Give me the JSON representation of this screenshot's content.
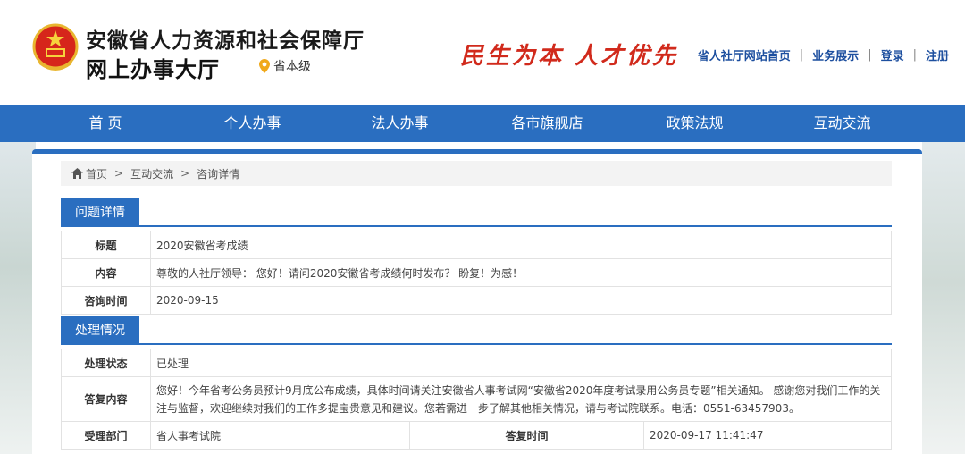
{
  "header": {
    "title": "安徽省人力资源和社会保障厅",
    "subtitle": "网上办事大厅",
    "location": "省本级",
    "slogan": "民生为本 人才优先",
    "links": [
      {
        "label": "省人社厅网站首页"
      },
      {
        "label": "业务展示"
      },
      {
        "label": "登录"
      },
      {
        "label": "注册"
      }
    ],
    "link_separator": "|"
  },
  "nav": {
    "items": [
      {
        "label": "首 页"
      },
      {
        "label": "个人办事"
      },
      {
        "label": "法人办事"
      },
      {
        "label": "各市旗舰店"
      },
      {
        "label": "政策法规"
      },
      {
        "label": "互动交流"
      }
    ]
  },
  "breadcrumb": {
    "items": [
      "首页",
      "互动交流",
      "咨询详情"
    ],
    "separator": ">"
  },
  "question": {
    "section_title": "问题详情",
    "rows": [
      {
        "label": "标题",
        "value": "2020安徽省考成绩"
      },
      {
        "label": "内容",
        "value": "尊敬的人社厅领导： 您好！请问2020安徽省考成绩何时发布？ 盼复！为感！"
      },
      {
        "label": "咨询时间",
        "value": "2020-09-15"
      }
    ]
  },
  "handling": {
    "section_title": "处理情况",
    "status_label": "处理状态",
    "status_value": "已处理",
    "reply_label": "答复内容",
    "reply_value": "您好！今年省考公务员预计9月底公布成绩，具体时间请关注安徽省人事考试网“安徽省2020年度考试录用公务员专题”相关通知。 感谢您对我们工作的关注与监督，欢迎继续对我们的工作多提宝贵意见和建议。您若需进一步了解其他相关情况，请与考试院联系。电话：0551-63457903。",
    "dept_label": "受理部门",
    "dept_value": "省人事考试院",
    "time_label": "答复时间",
    "time_value": "2020-09-17 11:41:47"
  },
  "colors": {
    "primary": "#2a6ec0",
    "slogan": "#d12a1c",
    "link": "#1d4f9f"
  }
}
